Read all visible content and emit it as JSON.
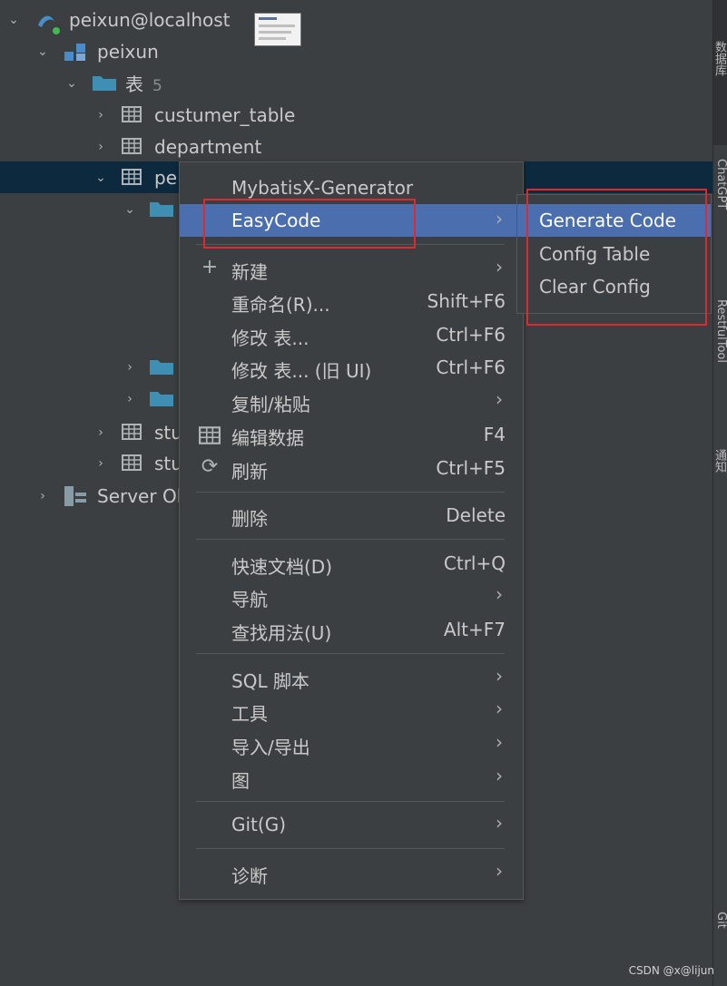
{
  "tree": {
    "connection": "peixun@localhost",
    "schema": "peixun",
    "tables_folder": "表",
    "tables_count": "5",
    "items": [
      "custumer_table",
      "department",
      "pe",
      "stu",
      "stu"
    ],
    "server_objects": "Server Ol"
  },
  "sidebar": {
    "tab1": "数据库",
    "tab2": "ChatGPT",
    "tab3": "RestfulTool",
    "tab4": "通知",
    "tab5": "Git"
  },
  "context_menu": {
    "items": [
      {
        "label": "MybatisX-Generator",
        "shortcut": ""
      },
      {
        "label": "EasyCode",
        "shortcut": ""
      },
      {
        "label": "新建",
        "shortcut": ""
      },
      {
        "label": "重命名(R)...",
        "shortcut": "Shift+F6"
      },
      {
        "label": "修改 表...",
        "shortcut": "Ctrl+F6"
      },
      {
        "label": "修改 表... (旧 UI)",
        "shortcut": "Ctrl+F6"
      },
      {
        "label": "复制/粘贴",
        "shortcut": ""
      },
      {
        "label": "编辑数据",
        "shortcut": "F4"
      },
      {
        "label": "刷新",
        "shortcut": "Ctrl+F5"
      },
      {
        "label": "删除",
        "shortcut": "Delete"
      },
      {
        "label": "快速文档(D)",
        "shortcut": "Ctrl+Q"
      },
      {
        "label": "导航",
        "shortcut": ""
      },
      {
        "label": "查找用法(U)",
        "shortcut": "Alt+F7"
      },
      {
        "label": "SQL 脚本",
        "shortcut": ""
      },
      {
        "label": "工具",
        "shortcut": ""
      },
      {
        "label": "导入/导出",
        "shortcut": ""
      },
      {
        "label": "图",
        "shortcut": ""
      },
      {
        "label": "Git(G)",
        "shortcut": ""
      },
      {
        "label": "诊断",
        "shortcut": ""
      }
    ]
  },
  "submenu": {
    "items": [
      "Generate Code",
      "Config Table",
      "Clear Config"
    ]
  },
  "colors": {
    "background": "#3c3f41",
    "selection": "#4b6eaf",
    "highlight_box": "#e0282f"
  },
  "watermark": "CSDN @x@lijun"
}
